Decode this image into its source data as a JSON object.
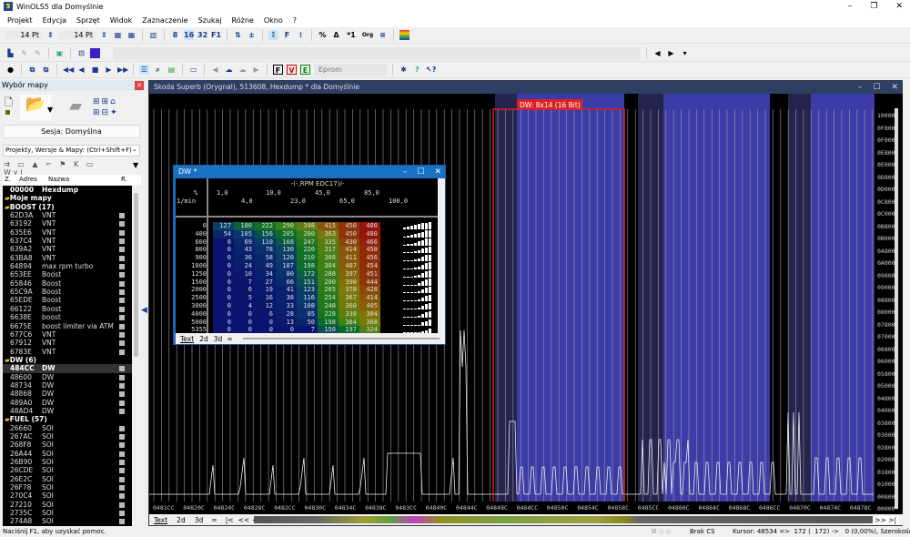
{
  "app": {
    "title": "WinOLS5 dla Domyślnie",
    "logo": "5"
  },
  "menu": [
    "Projekt",
    "Edycja",
    "Sprzęt",
    "Widok",
    "Zaznaczenie",
    "Szukaj",
    "Różne",
    "Okno",
    "?"
  ],
  "toolbar": {
    "font_size_1": "14 Pt",
    "font_size_2": "14 Pt",
    "eprom_label": "Eprom",
    "bits": [
      "8",
      "16",
      "32",
      "F1"
    ],
    "percent": "%",
    "delta": "Δ",
    "times_one": "*1",
    "org": "Org"
  },
  "left_panel": {
    "title": "Wybór mapy",
    "session_button": "Sesja: Domyślna",
    "search_placeholder": "Projekty, Wersje & Mapy:  (Ctrl+Shift+F)",
    "filter_label": "Wyl",
    "columns": [
      "Z.",
      "Adres",
      "Nazwa",
      "R."
    ],
    "rows": [
      {
        "type": "item",
        "addr": "00000",
        "name": "Hexdump",
        "bold": true
      },
      {
        "type": "group",
        "name": "Moje mapy"
      },
      {
        "type": "group",
        "name": "BOOST (17)"
      },
      {
        "type": "item",
        "addr": "62D3A",
        "name": "VNT"
      },
      {
        "type": "item",
        "addr": "63192",
        "name": "VNT"
      },
      {
        "type": "item",
        "addr": "635E6",
        "name": "VNT"
      },
      {
        "type": "item",
        "addr": "637C4",
        "name": "VNT"
      },
      {
        "type": "item",
        "addr": "639A2",
        "name": "VNT"
      },
      {
        "type": "item",
        "addr": "63BA8",
        "name": "VNT"
      },
      {
        "type": "item",
        "addr": "64894",
        "name": "max rpm turbo"
      },
      {
        "type": "item",
        "addr": "653EE",
        "name": "Boost"
      },
      {
        "type": "item",
        "addr": "65846",
        "name": "Boost"
      },
      {
        "type": "item",
        "addr": "65C9A",
        "name": "Boost"
      },
      {
        "type": "item",
        "addr": "65EDE",
        "name": "Boost"
      },
      {
        "type": "item",
        "addr": "66122",
        "name": "Boost"
      },
      {
        "type": "item",
        "addr": "6638E",
        "name": "boost"
      },
      {
        "type": "item",
        "addr": "6675E",
        "name": "boost limiter via ATM"
      },
      {
        "type": "item",
        "addr": "677C6",
        "name": "VNT"
      },
      {
        "type": "item",
        "addr": "67912",
        "name": "VNT"
      },
      {
        "type": "item",
        "addr": "6783E",
        "name": "VNT"
      },
      {
        "type": "group",
        "name": "DW (6)"
      },
      {
        "type": "item",
        "addr": "484CC",
        "name": "DW",
        "bold": true,
        "selected": true
      },
      {
        "type": "item",
        "addr": "48600",
        "name": "DW"
      },
      {
        "type": "item",
        "addr": "48734",
        "name": "DW"
      },
      {
        "type": "item",
        "addr": "48868",
        "name": "DW"
      },
      {
        "type": "item",
        "addr": "489A0",
        "name": "DW"
      },
      {
        "type": "item",
        "addr": "48AD4",
        "name": "DW"
      },
      {
        "type": "group",
        "name": "FUEL (57)"
      },
      {
        "type": "item",
        "addr": "26660",
        "name": "SOI"
      },
      {
        "type": "item",
        "addr": "267AC",
        "name": "SOI"
      },
      {
        "type": "item",
        "addr": "268F8",
        "name": "SOI"
      },
      {
        "type": "item",
        "addr": "26A44",
        "name": "SOI"
      },
      {
        "type": "item",
        "addr": "26B90",
        "name": "SOI"
      },
      {
        "type": "item",
        "addr": "26CDE",
        "name": "SOI"
      },
      {
        "type": "item",
        "addr": "26E2C",
        "name": "SOI"
      },
      {
        "type": "item",
        "addr": "26F78",
        "name": "SOI"
      },
      {
        "type": "item",
        "addr": "270C4",
        "name": "SOI"
      },
      {
        "type": "item",
        "addr": "27210",
        "name": "SOI"
      },
      {
        "type": "item",
        "addr": "2735C",
        "name": "SOI"
      },
      {
        "type": "item",
        "addr": "274A8",
        "name": "SOI"
      }
    ]
  },
  "hex_window": {
    "title": "Skoda Superb (Orygnal), 513608, Hexdump * dla Domyślnie",
    "selection_label": "DW: 8x14 (16 Bit)",
    "x_labels": [
      "0481CC",
      "04820C",
      "04824C",
      "04828C",
      "0482CC",
      "04830C",
      "04834C",
      "04838C",
      "0483CC",
      "04840C",
      "04844C",
      "04848C",
      "0484CC",
      "04850C",
      "04854C",
      "04858C",
      "0485CC",
      "04860C",
      "04864C",
      "04868C",
      "0486CC",
      "04870C",
      "04874C",
      "04878C"
    ],
    "y_labels": [
      "10000",
      "0F800",
      "0F000",
      "0E800",
      "0E000",
      "0D800",
      "0D000",
      "0C800",
      "0C000",
      "0B800",
      "0B000",
      "0A800",
      "0A000",
      "09800",
      "09000",
      "08800",
      "08000",
      "07800",
      "07000",
      "06800",
      "06000",
      "05800",
      "05000",
      "04800",
      "04000",
      "03800",
      "03000",
      "02800",
      "02000",
      "01800",
      "01000",
      "00800",
      "00000"
    ],
    "tabs": [
      "Text",
      "2d",
      "3d",
      "═"
    ],
    "nav_left": [
      "|<",
      "<<",
      "<"
    ],
    "nav_right": [
      ">",
      ">>",
      ">|"
    ],
    "colors": {
      "selected_region": "#3c3ca8",
      "dim_region": "#24244e",
      "selection_border": "#e02020"
    }
  },
  "map_window": {
    "title": "DW *",
    "axis_title": "-(-,RPM EDC17)/-",
    "x_unit": "%",
    "y_unit": "1/min",
    "x_axis": [
      "1,0",
      "4,0",
      "10,0",
      "23,0",
      "45,0",
      "65,0",
      "85,0",
      "100,0"
    ],
    "y_axis": [
      "0",
      "400",
      "600",
      "800",
      "900",
      "1000",
      "1250",
      "1500",
      "2000",
      "2500",
      "3000",
      "4000",
      "5000",
      "5355"
    ],
    "values": [
      [
        127,
        180,
        222,
        290,
        348,
        415,
        450,
        480
      ],
      [
        54,
        105,
        156,
        205,
        280,
        363,
        450,
        480
      ],
      [
        0,
        69,
        110,
        168,
        247,
        335,
        430,
        466
      ],
      [
        0,
        43,
        78,
        130,
        220,
        317,
        414,
        458
      ],
      [
        0,
        36,
        58,
        120,
        210,
        308,
        411,
        456
      ],
      [
        0,
        24,
        49,
        107,
        198,
        304,
        407,
        454
      ],
      [
        0,
        10,
        34,
        80,
        172,
        288,
        397,
        451
      ],
      [
        0,
        7,
        27,
        66,
        151,
        280,
        390,
        444
      ],
      [
        0,
        6,
        19,
        41,
        123,
        265,
        378,
        428
      ],
      [
        0,
        5,
        16,
        38,
        116,
        254,
        367,
        414
      ],
      [
        0,
        4,
        12,
        33,
        108,
        248,
        360,
        405
      ],
      [
        0,
        0,
        6,
        28,
        85,
        228,
        338,
        384
      ],
      [
        0,
        0,
        0,
        13,
        50,
        198,
        304,
        368
      ],
      [
        0,
        0,
        0,
        0,
        7,
        150,
        197,
        324
      ]
    ],
    "tabs": [
      "Text",
      "2d",
      "3d",
      "═"
    ]
  },
  "status": {
    "help": "Naciśnij F1, aby uzyskać pomoc.",
    "cs": "Brak CS",
    "cursor": "Kursor: 48534 =>  172 (  172) ->   0 (0,00%), Szerokość: 8"
  }
}
